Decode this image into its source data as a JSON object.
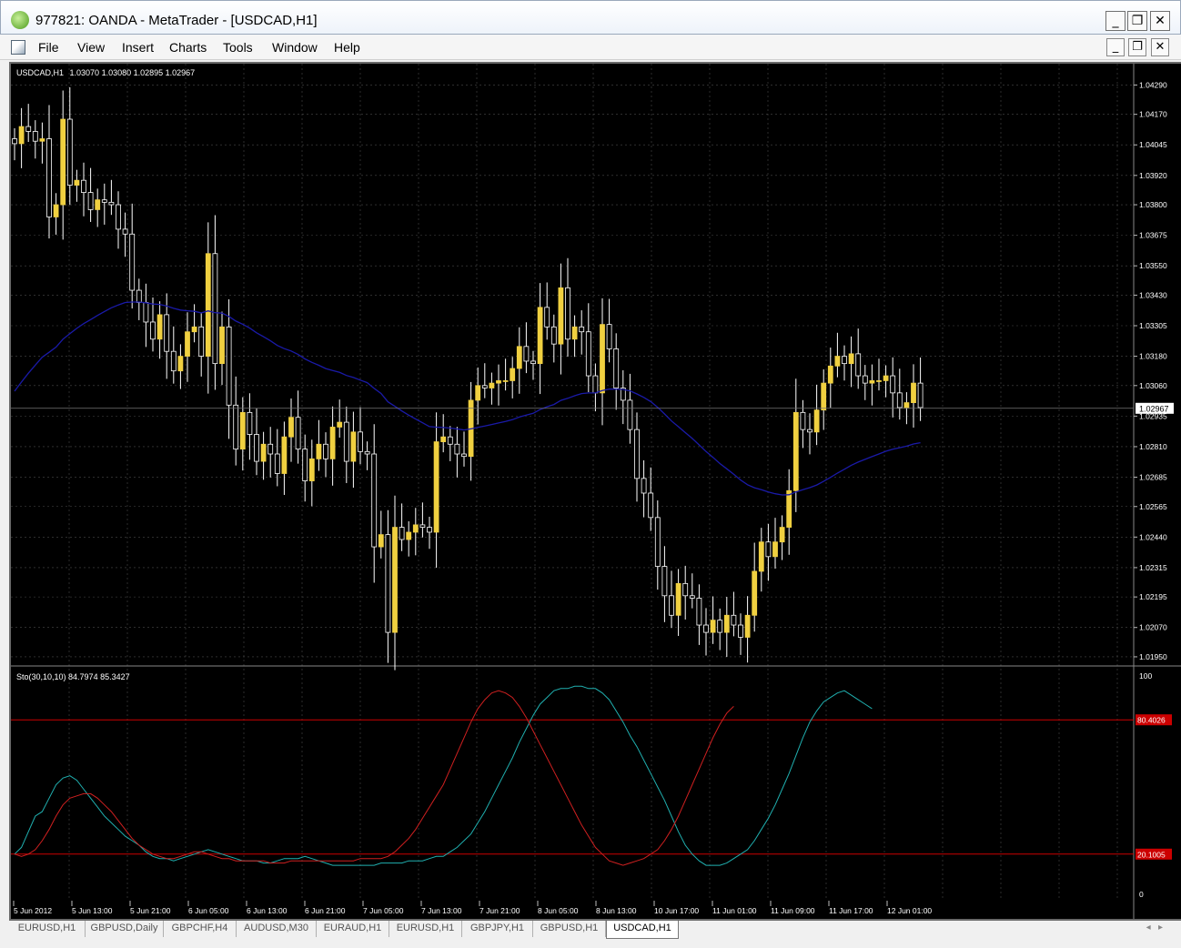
{
  "window": {
    "title": "977821: OANDA - MetaTrader - [USDCAD,H1]"
  },
  "menu": [
    "File",
    "View",
    "Insert",
    "Charts",
    "Tools",
    "Window",
    "Help"
  ],
  "chart_data": [
    {
      "type": "candlestick",
      "title": "USDCAD,H1",
      "ohlc_header": "1.03070 1.03080 1.02895 1.02967",
      "current_price": "1.02967",
      "ylim": [
        1.0192,
        1.0434
      ],
      "y_ticks": [
        "1.04290",
        "1.04170",
        "1.04045",
        "1.03920",
        "1.03800",
        "1.03675",
        "1.03550",
        "1.03430",
        "1.03305",
        "1.03180",
        "1.03060",
        "1.02935",
        "1.02810",
        "1.02685",
        "1.02565",
        "1.02440",
        "1.02315",
        "1.02195",
        "1.02070",
        "1.01950"
      ],
      "x_ticks": [
        "5 Jun 2012",
        "5 Jun 13:00",
        "5 Jun 21:00",
        "6 Jun 05:00",
        "6 Jun 13:00",
        "6 Jun 21:00",
        "7 Jun 05:00",
        "7 Jun 13:00",
        "7 Jun 21:00",
        "8 Jun 05:00",
        "8 Jun 13:00",
        "10 Jun 17:00",
        "11 Jun 01:00",
        "11 Jun 09:00",
        "11 Jun 17:00",
        "12 Jun 01:00"
      ],
      "colors": {
        "bull": "#f0d040",
        "bear": "#000000",
        "wick": "#ffffff",
        "ma": "#1a1aa8",
        "grid": "#4a4a4a"
      },
      "close": [
        1.0405,
        1.0412,
        1.041,
        1.0406,
        1.0407,
        1.0375,
        1.038,
        1.0415,
        1.0388,
        1.039,
        1.0385,
        1.0378,
        1.0382,
        1.0381,
        1.038,
        1.037,
        1.0368,
        1.0345,
        1.034,
        1.0332,
        1.0325,
        1.0335,
        1.032,
        1.0312,
        1.0318,
        1.0328,
        1.033,
        1.0318,
        1.036,
        1.0315,
        1.033,
        1.0298,
        1.028,
        1.0295,
        1.0286,
        1.0275,
        1.0282,
        1.0278,
        1.027,
        1.0285,
        1.0293,
        1.028,
        1.0267,
        1.0276,
        1.0282,
        1.0276,
        1.0289,
        1.0291,
        1.0275,
        1.0287,
        1.0279,
        1.0278,
        1.024,
        1.0245,
        1.0205,
        1.0248,
        1.0243,
        1.0246,
        1.0249,
        1.0248,
        1.0246,
        1.0283,
        1.0285,
        1.0282,
        1.0278,
        1.0277,
        1.03,
        1.0306,
        1.0305,
        1.0307,
        1.0308,
        1.0308,
        1.0313,
        1.0322,
        1.0316,
        1.0315,
        1.0338,
        1.033,
        1.0323,
        1.0346,
        1.0325,
        1.033,
        1.0328,
        1.031,
        1.0303,
        1.0331,
        1.0321,
        1.0305,
        1.03,
        1.0288,
        1.0268,
        1.0262,
        1.0252,
        1.0232,
        1.022,
        1.0212,
        1.0225,
        1.022,
        1.0219,
        1.0208,
        1.0205,
        1.021,
        1.0205,
        1.0212,
        1.0208,
        1.0203,
        1.0212,
        1.023,
        1.0242,
        1.0236,
        1.0242,
        1.0248,
        1.0263,
        1.0295,
        1.0288,
        1.0287,
        1.0296,
        1.0307,
        1.0314,
        1.0318,
        1.0315,
        1.0319,
        1.031,
        1.0307,
        1.0308,
        1.0308,
        1.031,
        1.0303,
        1.0297,
        1.0299,
        1.0307,
        1.0297
      ],
      "moving_average": {
        "color": "#1a1aa8"
      },
      "indicator": {
        "name": "Sto(30,10,10) 84.7974 85.3427",
        "ylim": [
          0,
          100
        ],
        "y_ticks": [
          "100",
          "0"
        ],
        "levels": [
          {
            "value": 80,
            "label": "80.4026",
            "color": "#cc0000"
          },
          {
            "value": 20,
            "label": "20.1005",
            "color": "#cc0000"
          }
        ],
        "series": [
          {
            "color": "#20b0b0",
            "values": [
              20,
              23,
              30,
              37,
              39,
              45,
              51,
              54,
              55,
              53,
              49,
              45,
              41,
              37,
              34,
              31,
              28,
              26,
              24,
              21,
              19,
              18,
              18,
              17,
              18,
              19,
              20,
              21,
              22,
              21,
              20,
              19,
              18,
              17,
              17,
              17,
              16,
              16,
              17,
              18,
              18,
              18,
              19,
              18,
              17,
              16,
              15,
              15,
              15,
              15,
              15,
              15,
              15,
              16,
              16,
              16,
              16,
              17,
              17,
              17,
              18,
              19,
              19,
              21,
              23,
              26,
              29,
              34,
              39,
              45,
              51,
              57,
              63,
              70,
              76,
              82,
              87,
              90,
              93,
              94,
              94,
              95,
              95,
              94,
              94,
              92,
              89,
              84,
              79,
              73,
              68,
              62,
              56,
              50,
              44,
              37,
              30,
              24,
              20,
              17,
              15,
              15,
              15,
              16,
              18,
              20,
              22,
              26,
              31,
              36,
              42,
              49,
              56,
              64,
              72,
              79,
              84,
              88,
              90,
              92,
              93,
              91,
              89,
              87,
              85
            ]
          },
          {
            "color": "#d02020",
            "values": [
              20,
              19,
              20,
              22,
              26,
              31,
              37,
              42,
              45,
              46,
              47,
              47,
              45,
              42,
              39,
              35,
              31,
              27,
              24,
              22,
              20,
              19,
              18,
              18,
              19,
              20,
              21,
              21,
              20,
              19,
              18,
              18,
              17,
              17,
              17,
              17,
              17,
              16,
              16,
              16,
              17,
              17,
              17,
              17,
              17,
              17,
              17,
              17,
              17,
              17,
              18,
              18,
              18,
              18,
              19,
              21,
              24,
              27,
              31,
              36,
              41,
              46,
              51,
              58,
              65,
              72,
              79,
              85,
              89,
              92,
              93,
              92,
              90,
              86,
              81,
              75,
              69,
              63,
              57,
              51,
              45,
              39,
              33,
              28,
              23,
              20,
              17,
              16,
              15,
              16,
              17,
              18,
              20,
              22,
              26,
              31,
              37,
              44,
              51,
              58,
              65,
              72,
              78,
              83,
              86
            ]
          }
        ]
      }
    }
  ],
  "tabs": [
    "EURUSD,H1",
    "GBPUSD,Daily",
    "GBPCHF,H4",
    "AUDUSD,M30",
    "EURAUD,H1",
    "EURUSD,H1",
    "GBPJPY,H1",
    "GBPUSD,H1",
    "USDCAD,H1"
  ],
  "active_tab": 8
}
